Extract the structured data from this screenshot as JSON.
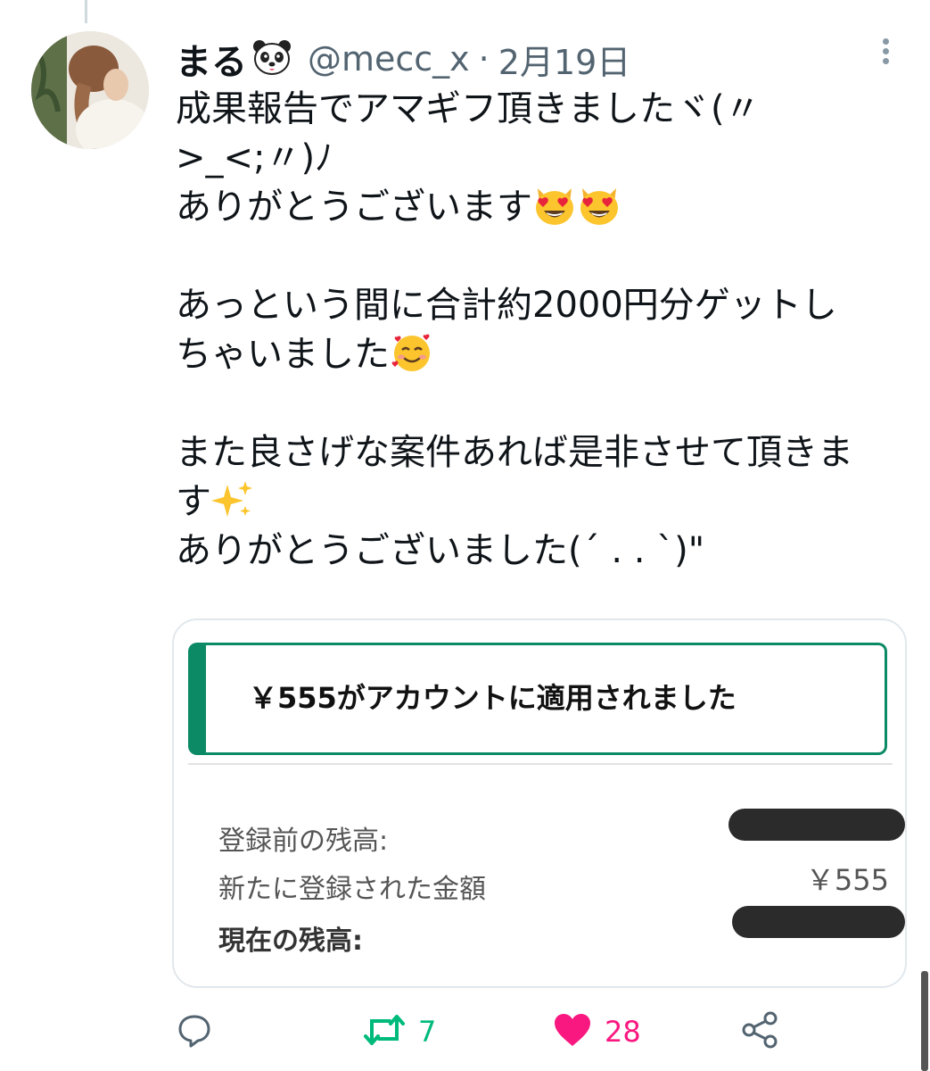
{
  "author": {
    "display_name": "まる",
    "name_emoji": "panda-face-icon",
    "handle": "@mecc_x",
    "separator": "·",
    "date": "2月19日"
  },
  "tweet": {
    "lines": [
      "成果報告でアマギフ頂きましたヾ(〃",
      ">_<;〃)ﾉ",
      "ありがとうございます",
      "",
      "あっという間に合計約2000円分ゲットし",
      "ちゃいました",
      "",
      "また良さげな案件あれば是非させて頂きま",
      "す",
      "ありがとうございました(ˊ . . ˋ)\""
    ],
    "emojis": [
      "smiling-cat-heart-eyes-icon",
      "smiling-face-with-hearts-icon",
      "sparkles-icon"
    ]
  },
  "card": {
    "alert_title": "￥555がアカウントに適用されました",
    "rows": [
      {
        "label": "登録前の残高:",
        "value": "",
        "redacted": true
      },
      {
        "label": "新たに登録された金額",
        "value": "￥555",
        "redacted": false
      },
      {
        "label": "現在の残高:",
        "value": "",
        "redacted": true
      }
    ]
  },
  "actions": {
    "reply_count": "",
    "retweet_count": "7",
    "like_count": "28",
    "share_count": ""
  },
  "colors": {
    "retweet_green": "#00ba7c",
    "like_pink": "#f91880",
    "alert_green": "#0b8a65",
    "secondary_text": "#536471"
  }
}
